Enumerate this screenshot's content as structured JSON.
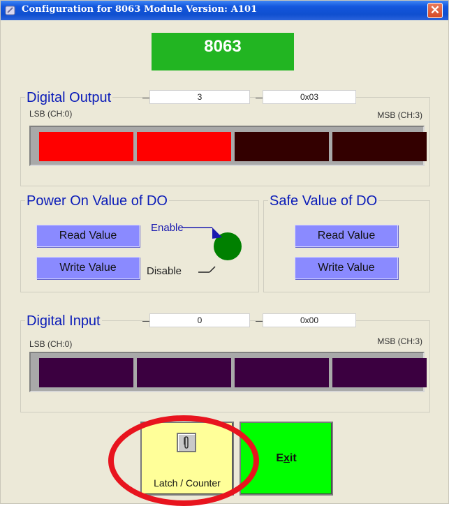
{
  "window": {
    "title": "Configuration for 8063 Module Version: A101",
    "close_symbol": "✕"
  },
  "module": {
    "name": "8063"
  },
  "digital_output": {
    "legend": "Digital Output",
    "decimal_value": "3",
    "hex_value": "0x03",
    "lsb_label": "LSB (CH:0)",
    "msb_label": "MSB (CH:3)",
    "channels": [
      {
        "ch": 0,
        "on": true,
        "color": "#ff0000"
      },
      {
        "ch": 1,
        "on": true,
        "color": "#ff0000"
      },
      {
        "ch": 2,
        "on": false,
        "color": "#330000"
      },
      {
        "ch": 3,
        "on": false,
        "color": "#330000"
      }
    ]
  },
  "power_on": {
    "legend": "Power On Value of DO",
    "read_label": "Read Value",
    "write_label": "Write Value",
    "enable_label": "Enable",
    "disable_label": "Disable",
    "switch_state": "enable",
    "switch_color": "#008000"
  },
  "safe_value": {
    "legend": "Safe Value of DO",
    "read_label": "Read Value",
    "write_label": "Write Value"
  },
  "digital_input": {
    "legend": "Digital Input",
    "decimal_value": "0",
    "hex_value": "0x00",
    "lsb_label": "LSB (CH:0)",
    "msb_label": "MSB (CH:3)",
    "channels": [
      {
        "ch": 0,
        "on": false,
        "color": "#3b0040"
      },
      {
        "ch": 1,
        "on": false,
        "color": "#3b0040"
      },
      {
        "ch": 2,
        "on": false,
        "color": "#3b0040"
      },
      {
        "ch": 3,
        "on": false,
        "color": "#3b0040"
      }
    ]
  },
  "actions": {
    "latch_label": "Latch / Counter",
    "exit_label": "Exit",
    "exit_accel": "x"
  },
  "colors": {
    "title_bar": "#0f4fd0",
    "legend_text": "#0a1bb8",
    "button_blue": "#8a8aff",
    "latch_bg": "#ffff99",
    "exit_bg": "#00ff00",
    "highlight": "#e8141e"
  }
}
